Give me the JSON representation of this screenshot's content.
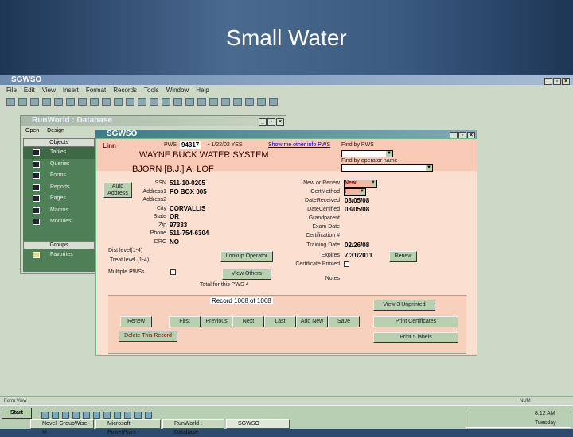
{
  "slide": {
    "title": "Small Water"
  },
  "app": {
    "title": "SGWSO",
    "menu": [
      "File",
      "Edit",
      "View",
      "Insert",
      "Format",
      "Records",
      "Tools",
      "Window",
      "Help"
    ],
    "status": "Form View",
    "num": "NUM"
  },
  "db": {
    "title": "RunWorld : Database",
    "toolbar": [
      "Open",
      "Design"
    ],
    "objects_header": "Objects",
    "objects": [
      "Tables",
      "Queries",
      "Forms",
      "Reports",
      "Pages",
      "Macros",
      "Modules"
    ],
    "groups_header": "Groups",
    "groups": [
      "Favorites"
    ]
  },
  "form": {
    "title": "SGWSO",
    "county": "Linn",
    "pws_label": "PWS",
    "pws": "94317",
    "pws_extra": "• 1/22/02 YES",
    "link": "Show me other info PWS",
    "find_pws_label": "Find by PWS",
    "find_name_label": "Find by operator name",
    "system": "WAYNE BUCK WATER SYSTEM",
    "operator": "BJORN [B.J.] A. LOF",
    "auto_address": "Auto Address",
    "fields": [
      {
        "label": "SSN",
        "value": "511-10-0205"
      },
      {
        "label": "Address1",
        "value": "PO BOX 005"
      },
      {
        "label": "Address2",
        "value": ""
      },
      {
        "label": "City",
        "value": "CORVALLIS"
      },
      {
        "label": "State",
        "value": "OR"
      },
      {
        "label": "Zip",
        "value": "97333"
      },
      {
        "label": "Phone",
        "value": "511-754-6304"
      },
      {
        "label": "DRC",
        "value": "NO"
      }
    ],
    "right_fields": [
      {
        "label": "New or Renew",
        "value": "New"
      },
      {
        "label": "CertMethod",
        "value": "I"
      },
      {
        "label": "DateReceived",
        "value": "03/05/08"
      },
      {
        "label": "DateCertified",
        "value": "03/05/08"
      },
      {
        "label": "Grandparent",
        "value": ""
      },
      {
        "label": "Exam Date",
        "value": ""
      },
      {
        "label": "Certification #",
        "value": ""
      },
      {
        "label": "Training Date",
        "value": "02/26/08"
      },
      {
        "label": "Expires",
        "value": "7/31/2011"
      },
      {
        "label": "Certificate Printed",
        "value": ""
      },
      {
        "label": "Notes",
        "value": ""
      }
    ],
    "dist_level": "Dist level(1-4)",
    "treat_level": "Treat level (1-4)",
    "multiple": "Multiple PWSs",
    "lookup": "Lookup Operator",
    "view_others": "View Others",
    "total": "Total for this PWS 4",
    "renew": "Renew",
    "record": "Record 1068 of 1068",
    "nav": [
      "Renew",
      "First",
      "Previous",
      "Next",
      "Last",
      "Add New",
      "Save"
    ],
    "delete": "Delete This Record",
    "view_unprinted": "View 3 Unprinted",
    "print_certs": "Print Certificates",
    "print_labels": "Print 5 labels"
  },
  "taskbar": {
    "start": "Start",
    "tasks": [
      "Novell GroupWise - M",
      "Microsoft PowerPoint -",
      "RunWorld : Database",
      "SGWSO"
    ],
    "time": "8:12 AM",
    "day": "Tuesday"
  }
}
